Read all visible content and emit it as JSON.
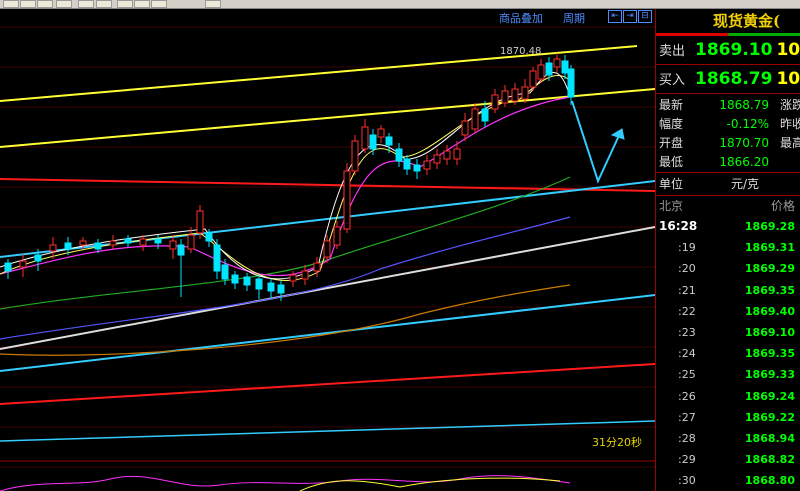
{
  "toolbar": {
    "buttons": [
      "tb-1",
      "tb-2",
      "tb-3",
      "tb-4",
      "tb-5",
      "tb-6",
      "tb-7",
      "tb-8",
      "tb-9",
      "tb-10"
    ]
  },
  "chart": {
    "overlay_label": "商品叠加",
    "period_label": "周期",
    "nav_buttons": [
      "⇤",
      "⇥",
      "⊟"
    ],
    "high_label": "1870.48",
    "countdown": "31分20秒",
    "colors": {
      "up": "#ff3030",
      "down": "#00e5ff",
      "ma_short": "#ffffff",
      "ma_mid": "#ffff00",
      "ma_long": "#ff00ff"
    }
  },
  "panel": {
    "title": "现货黄金(",
    "sell_label": "卖出",
    "sell_price": "1869.10",
    "sell_vol": "10",
    "buy_label": "买入",
    "buy_price": "1868.79",
    "buy_vol": "10",
    "stats": [
      {
        "label": "最新",
        "value": "1868.79",
        "label2": "涨跌"
      },
      {
        "label": "幅度",
        "value": "-0.12%",
        "label2": "昨收"
      },
      {
        "label": "开盘",
        "value": "1870.70",
        "label2": "最高"
      },
      {
        "label": "最低",
        "value": "1866.20",
        "label2": ""
      }
    ],
    "unit_label": "单位",
    "unit_value": "元/克",
    "tick_header_left": "北京",
    "tick_header_right": "价格",
    "ticks": [
      {
        "time": "16:28",
        "price": "1869.28"
      },
      {
        "time": ":19",
        "price": "1869.31"
      },
      {
        "time": ":20",
        "price": "1869.29"
      },
      {
        "time": ":21",
        "price": "1869.35"
      },
      {
        "time": ":22",
        "price": "1869.40"
      },
      {
        "time": ":23",
        "price": "1869.10"
      },
      {
        "time": ":24",
        "price": "1869.35"
      },
      {
        "time": ":25",
        "price": "1869.33"
      },
      {
        "time": ":26",
        "price": "1869.24"
      },
      {
        "time": ":27",
        "price": "1869.22"
      },
      {
        "time": ":28",
        "price": "1868.94"
      },
      {
        "time": ":29",
        "price": "1868.82"
      },
      {
        "time": ":30",
        "price": "1868.80"
      }
    ]
  }
}
